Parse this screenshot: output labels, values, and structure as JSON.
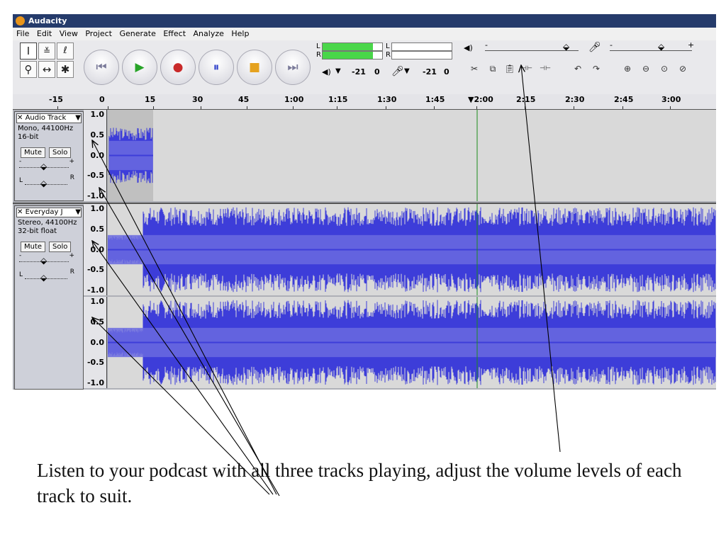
{
  "app": {
    "title": "Audacity"
  },
  "menu": [
    "File",
    "Edit",
    "View",
    "Project",
    "Generate",
    "Effect",
    "Analyze",
    "Help"
  ],
  "tools": {
    "tool_icons": [
      "select-tool-icon",
      "envelope-tool-icon",
      "draw-tool-icon",
      "zoom-tool-icon",
      "timeshift-tool-icon",
      "multi-tool-icon"
    ],
    "tool_glyphs": [
      "I",
      "≚",
      "ℓ",
      "⚲",
      "↔",
      "✱"
    ]
  },
  "transport": [
    {
      "name": "skip-start",
      "glyph": "⏮",
      "color": "#7a7a99"
    },
    {
      "name": "play",
      "glyph": "▶",
      "color": "#28a428"
    },
    {
      "name": "record",
      "glyph": "●",
      "color": "#c92a2a"
    },
    {
      "name": "pause",
      "glyph": "⏸",
      "color": "#2a3cc9"
    },
    {
      "name": "stop",
      "glyph": "■",
      "color": "#e5a21f"
    },
    {
      "name": "skip-end",
      "glyph": "⏭",
      "color": "#7a7a99"
    }
  ],
  "meters": {
    "out_left_label": "L",
    "out_right_label": "R",
    "in_left_label": "L",
    "in_right_label": "R",
    "out_value": "-21",
    "out_zero": "0",
    "in_value": "-21",
    "in_zero": "0",
    "out_level": 0.85
  },
  "mixer": {
    "minus": "-",
    "plus": "+"
  },
  "ruler": {
    "labels": [
      "-15",
      "0",
      "15",
      "30",
      "45",
      "1:00",
      "1:15",
      "1:30",
      "1:45",
      "2:00",
      "2:15",
      "2:30",
      "2:45",
      "3:00"
    ],
    "playhead_label": "2:00"
  },
  "tracks": [
    {
      "name": "Audio Track",
      "format": "Mono, 44100Hz",
      "depth": "16-bit",
      "mute": "Mute",
      "solo": "Solo",
      "gain_minus": "-",
      "gain_plus": "+",
      "pan_left": "L",
      "pan_right": "R",
      "scale": [
        "1.0",
        "0.5",
        "0.0",
        "-0.5",
        "-1.0"
      ],
      "channels": 1
    },
    {
      "name": "Everyday J",
      "format": "Stereo, 44100Hz",
      "depth": "32-bit float",
      "mute": "Mute",
      "solo": "Solo",
      "gain_minus": "-",
      "gain_plus": "+",
      "pan_left": "L",
      "pan_right": "R",
      "scale": [
        "1.0",
        "0.5",
        "0.0",
        "-0.5",
        "-1.0"
      ],
      "scale2": [
        "1.0",
        "0.5",
        "0.0",
        "-0.5",
        "-1.0"
      ],
      "channels": 2
    }
  ],
  "colors": {
    "wave_dark": "#3d3dd9",
    "wave_light": "#6a6adf",
    "selection": "#c0c0c0",
    "playhead": "#1c8c1c"
  },
  "caption": "Listen to your podcast with all three tracks playing, adjust the volume levels of each track to suit."
}
